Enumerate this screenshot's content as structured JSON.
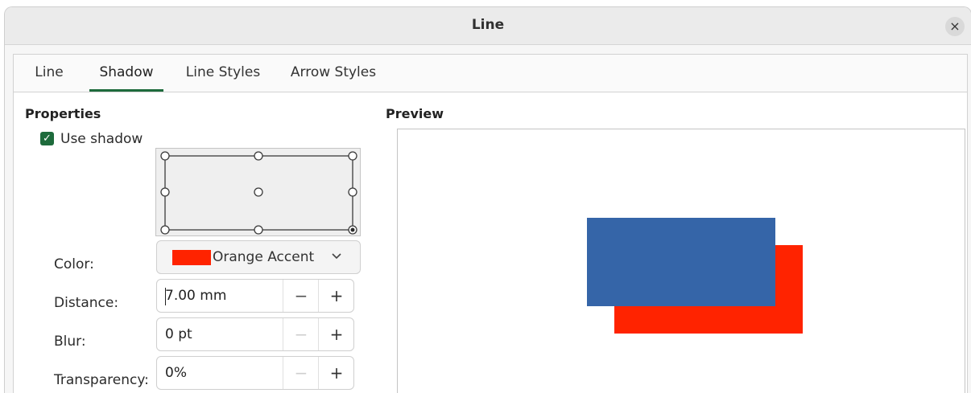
{
  "dialog": {
    "title": "Line",
    "close_glyph": "×"
  },
  "tabs": [
    {
      "label": "Line",
      "active": false
    },
    {
      "label": "Shadow",
      "active": true
    },
    {
      "label": "Line Styles",
      "active": false
    },
    {
      "label": "Arrow Styles",
      "active": false
    }
  ],
  "properties": {
    "heading": "Properties",
    "use_shadow": {
      "label": "Use shadow",
      "checked": true
    },
    "position_grid": {
      "selected": "bottom-right"
    },
    "color": {
      "label": "Color:",
      "value": "Orange Accent",
      "swatch": "#ff2300"
    },
    "distance": {
      "label": "Distance:",
      "value": "7.00 mm"
    },
    "blur": {
      "label": "Blur:",
      "value": "0 pt"
    },
    "transparency": {
      "label": "Transparency:",
      "value": "0%"
    }
  },
  "preview": {
    "heading": "Preview",
    "object_color": "#3565a8",
    "shadow_color": "#ff2300"
  },
  "icons": {
    "checkbox": "check-icon",
    "close": "close-icon",
    "dropdown": "chevron-down-icon",
    "minus": "minus-icon",
    "plus": "plus-icon"
  },
  "theme": {
    "accent": "#1e6b3c"
  }
}
